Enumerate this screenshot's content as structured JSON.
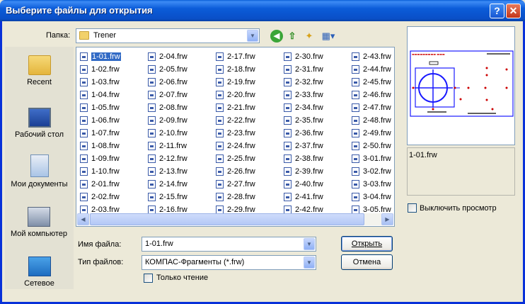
{
  "window": {
    "title": "Выберите файлы для открытия"
  },
  "folder": {
    "label": "Папка:",
    "value": "Trener"
  },
  "places": [
    {
      "label": "Recent",
      "icon": "recent-folder-icon"
    },
    {
      "label": "Рабочий стол",
      "icon": "desktop-icon"
    },
    {
      "label": "Мои документы",
      "icon": "documents-icon"
    },
    {
      "label": "Мой компьютер",
      "icon": "computer-icon"
    },
    {
      "label": "Сетевое",
      "icon": "network-icon"
    }
  ],
  "files": {
    "selected": "1-01.frw",
    "columns": [
      [
        "1-01.frw",
        "1-02.frw",
        "1-03.frw",
        "1-04.frw",
        "1-05.frw",
        "1-06.frw",
        "1-07.frw",
        "1-08.frw",
        "1-09.frw",
        "1-10.frw",
        "2-01.frw",
        "2-02.frw",
        "2-03.frw"
      ],
      [
        "2-04.frw",
        "2-05.frw",
        "2-06.frw",
        "2-07.frw",
        "2-08.frw",
        "2-09.frw",
        "2-10.frw",
        "2-11.frw",
        "2-12.frw",
        "2-13.frw",
        "2-14.frw",
        "2-15.frw",
        "2-16.frw"
      ],
      [
        "2-17.frw",
        "2-18.frw",
        "2-19.frw",
        "2-20.frw",
        "2-21.frw",
        "2-22.frw",
        "2-23.frw",
        "2-24.frw",
        "2-25.frw",
        "2-26.frw",
        "2-27.frw",
        "2-28.frw",
        "2-29.frw"
      ],
      [
        "2-30.frw",
        "2-31.frw",
        "2-32.frw",
        "2-33.frw",
        "2-34.frw",
        "2-35.frw",
        "2-36.frw",
        "2-37.frw",
        "2-38.frw",
        "2-39.frw",
        "2-40.frw",
        "2-41.frw",
        "2-42.frw"
      ],
      [
        "2-43.frw",
        "2-44.frw",
        "2-45.frw",
        "2-46.frw",
        "2-47.frw",
        "2-48.frw",
        "2-49.frw",
        "2-50.frw",
        "3-01.frw",
        "3-02.frw",
        "3-03.frw",
        "3-04.frw",
        "3-05.frw"
      ]
    ]
  },
  "filename": {
    "label": "Имя файла:",
    "value": "1-01.frw"
  },
  "filetype": {
    "label": "Тип файлов:",
    "value": "КОМПАС-Фрагменты (*.frw)"
  },
  "readonly": {
    "label": "Только чтение"
  },
  "buttons": {
    "open": "Открыть",
    "cancel": "Отмена"
  },
  "preview": {
    "filename": "1-01.frw",
    "disable_label": "Выключить просмотр"
  },
  "colors": {
    "titlebar": "#0a5fd8",
    "selection": "#316ac5",
    "drawing_blue": "#1a1aff",
    "drawing_red": "#cc0000"
  }
}
